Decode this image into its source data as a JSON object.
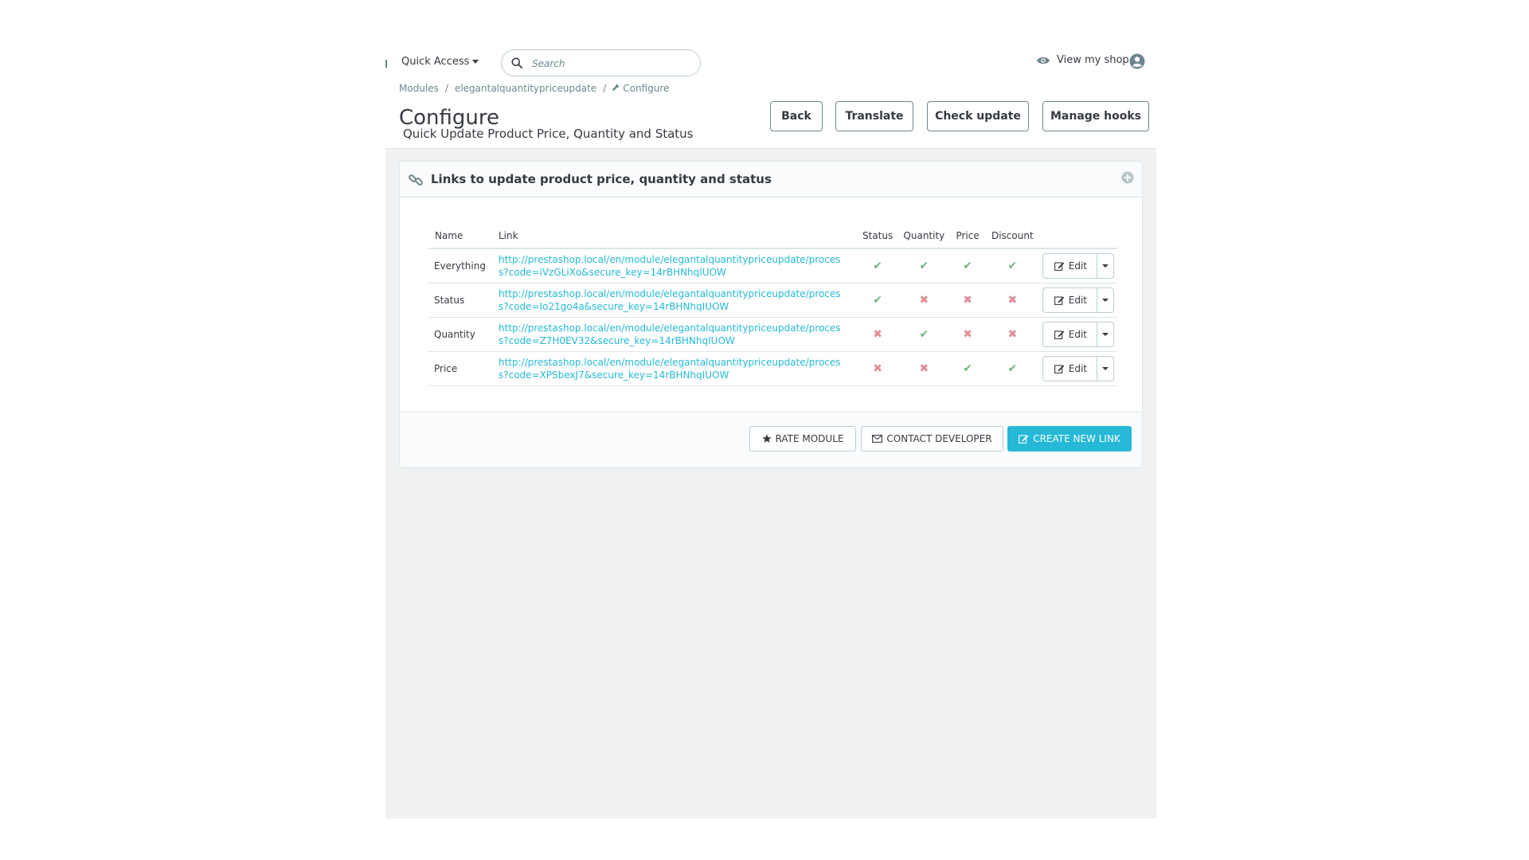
{
  "header": {
    "quick_access": "Quick Access",
    "search_placeholder": "Search",
    "view_shop": "View my shop"
  },
  "breadcrumb": [
    "Modules",
    "elegantalquantitypriceupdate",
    "Configure"
  ],
  "page": {
    "title": "Configure",
    "subtitle": "Quick Update Product Price, Quantity and Status"
  },
  "toolbar": {
    "back": "Back",
    "translate": "Translate",
    "check_update": "Check update",
    "manage_hooks": "Manage hooks"
  },
  "panel": {
    "title": "Links to update product price, quantity and status",
    "columns": [
      "Name",
      "Link",
      "Status",
      "Quantity",
      "Price",
      "Discount"
    ],
    "edit_label": "Edit",
    "rows": [
      {
        "name": "Everything",
        "link": "http://prestashop.local/en/module/elegantalquantitypriceupdate/process?code=iVzGLiXo&secure_key=14rBHNhqIUOW",
        "status": "✔",
        "quantity": "✔",
        "price": "✔",
        "discount": "✔"
      },
      {
        "name": "Status",
        "link": "http://prestashop.local/en/module/elegantalquantitypriceupdate/process?code=Io21go4a&secure_key=14rBHNhqIUOW",
        "status": "✔",
        "quantity": "✖",
        "price": "✖",
        "discount": "✖"
      },
      {
        "name": "Quantity",
        "link": "http://prestashop.local/en/module/elegantalquantitypriceupdate/process?code=Z7H0EV32&secure_key=14rBHNhqIUOW",
        "status": "✖",
        "quantity": "✔",
        "price": "✖",
        "discount": "✖"
      },
      {
        "name": "Price",
        "link": "http://prestashop.local/en/module/elegantalquantitypriceupdate/process?code=XPSbexJ7&secure_key=14rBHNhqIUOW",
        "status": "✖",
        "quantity": "✖",
        "price": "✔",
        "discount": "✔"
      }
    ],
    "footer": {
      "rate": "RATE MODULE",
      "contact": "CONTACT DEVELOPER",
      "create": "CREATE NEW LINK"
    }
  },
  "colors": {
    "accent": "#25b9d7",
    "ok": "#70b580",
    "error": "#e08f95"
  }
}
